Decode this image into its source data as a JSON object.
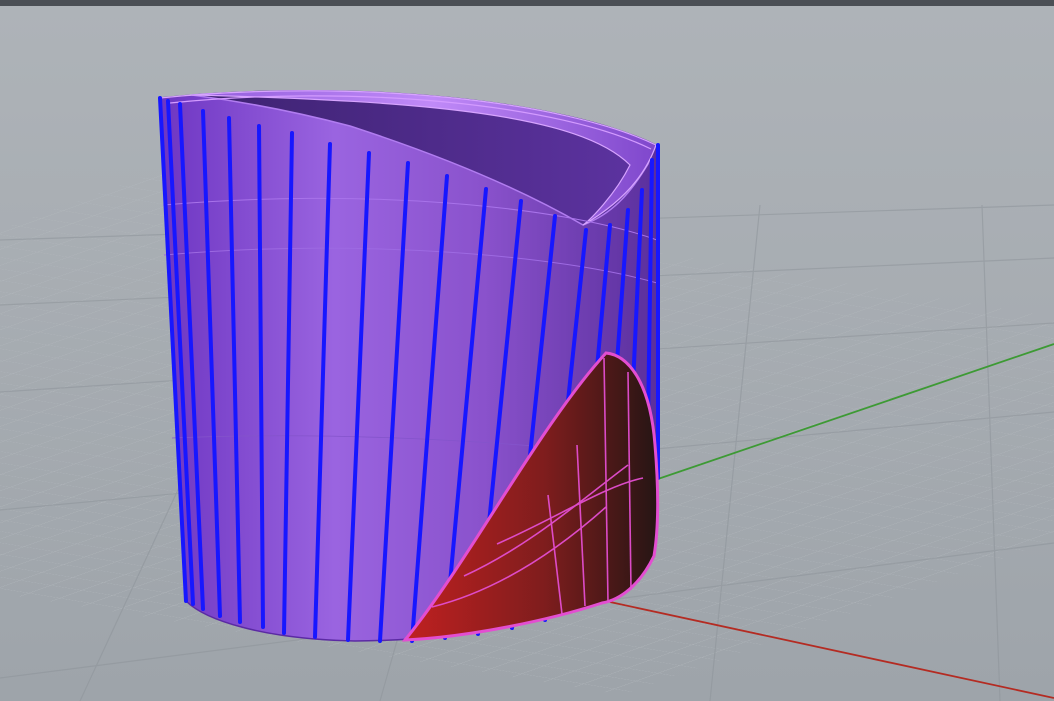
{
  "viewport": {
    "projection": "perspective",
    "display_mode": "shaded"
  },
  "colors": {
    "background_top": "#aeb3b8",
    "background_bottom": "#9ea4aa",
    "grid_minor": "#b3b8bd",
    "grid_major": "#8d9399",
    "x_axis": "#b42b22",
    "y_axis": "#3d9a34",
    "surface": "#8e58d8",
    "surface_highlight": "#b17cf0",
    "surface_dark": "#4b2a85",
    "selection_edge": "#1717ff",
    "cut_face": "#9e1c1c",
    "cut_edge": "#e34ed1"
  },
  "scene": {
    "objects": [
      {
        "name": "cylinder-shell",
        "selected": true
      },
      {
        "name": "cut-face",
        "selected": false
      }
    ]
  }
}
